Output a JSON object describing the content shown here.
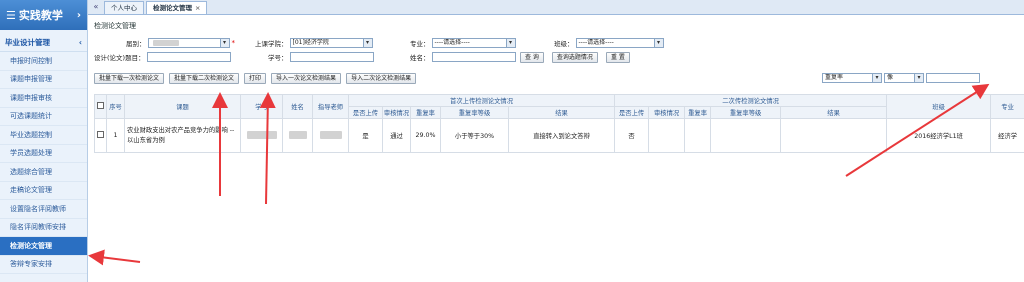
{
  "sidebar": {
    "brand": "实践教学",
    "brand_icon": "menu-list-icon",
    "group": "毕业设计管理",
    "items": [
      "申报时间控制",
      "课题申报管理",
      "课题申报审核",
      "可选课题统计",
      "毕业选题控制",
      "学员选题处理",
      "选题综合管理",
      "走稿论文管理",
      "设置隐名评阅教师",
      "隐名评阅教师安排",
      "检测论文管理",
      "答辩专家安排"
    ],
    "active_index": 10
  },
  "tabs": {
    "nav": "«",
    "items": [
      {
        "label": "个人中心"
      },
      {
        "label": "检测论文管理",
        "close": "×"
      }
    ]
  },
  "page": {
    "title": "检测论文管理"
  },
  "form": {
    "grade_label": "届别：",
    "grade_value": "",
    "required_mark": "*",
    "college_label": "上课学院：",
    "college_value": "[01]经济学院",
    "major_label": "专业：",
    "major_value": "----请选择----",
    "class_label": "班级：",
    "class_value": "----请选择----",
    "topic_label": "设计(论文)题目：",
    "student_id_label": "学号：",
    "name_label": "姓名：",
    "query_btn": "查 询",
    "stats_btn": "查询选题情况",
    "reset_btn": "重 置"
  },
  "toolbar": {
    "batch_download_1": "批量下载一次检测论文",
    "batch_download_2": "批量下载二次检测论文",
    "print": "打印",
    "import_1": "导入一次论文检测结果",
    "import_2": "导入二次论文检测结果",
    "filter_field": "重复率",
    "filter_op": "像",
    "search_btn": "查 找"
  },
  "table": {
    "group1": "首次上传检测论文情况",
    "group2": "二次传检测论文情况",
    "headers": {
      "seq": "序号",
      "topic": "课题",
      "student_id": "学号",
      "name": "姓名",
      "advisor": "指导老师",
      "uploaded": "是否上传",
      "audit": "审核情况",
      "rate": "重复率",
      "level": "重复率等级",
      "result": "结果",
      "uploaded2": "是否上传",
      "audit2": "审核情况",
      "rate2": "重复率",
      "level2": "重复率等级",
      "result2": "结果",
      "class": "班级",
      "major": "专业"
    },
    "rows": [
      {
        "seq": "1",
        "topic": "农业财政支出对农产品竞争力的影响 --以山东省为例",
        "uploaded": "是",
        "audit": "通过",
        "rate": "29.0%",
        "level": "小于等于30%",
        "result": "直接转入到论文答辩",
        "uploaded2": "否",
        "class": "2016经济学L1班",
        "major": "经济学"
      }
    ]
  },
  "colors": {
    "annotation": "#e8383b",
    "active_sidebar": "#2a6fc2"
  }
}
